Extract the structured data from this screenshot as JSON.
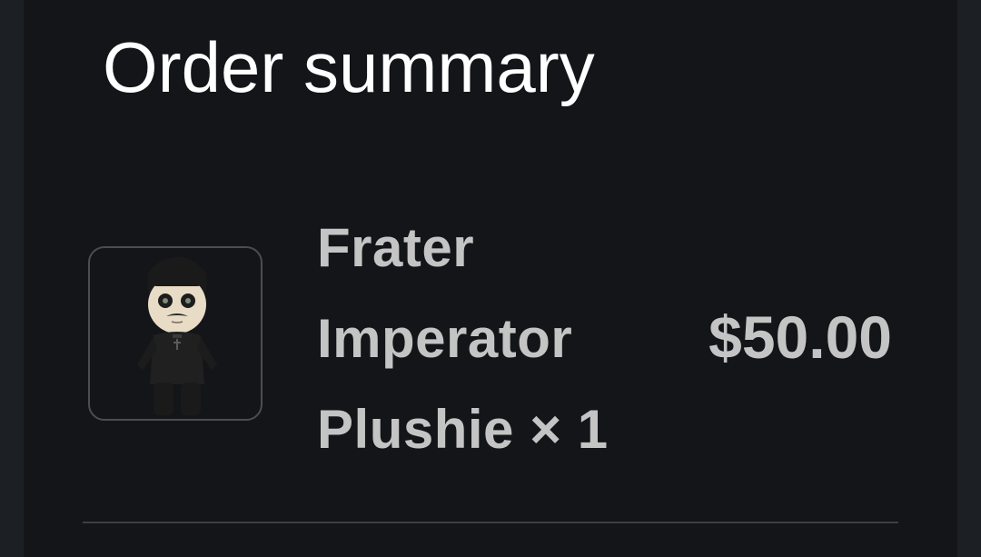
{
  "order_summary": {
    "title": "Order summary",
    "items": [
      {
        "name_lines": [
          "Frater",
          "Imperator",
          "Plushie × 1"
        ],
        "name": "Frater Imperator Plushie",
        "quantity": "1",
        "price": "$50.00",
        "image_icon": "plushie-product-image"
      }
    ]
  },
  "colors": {
    "page_background": "#1c1f23",
    "panel_background": "#131519",
    "title_text": "#ffffff",
    "item_text": "#c4c4c4",
    "thumbnail_border": "#4a4d52",
    "divider": "#3b3e43"
  }
}
